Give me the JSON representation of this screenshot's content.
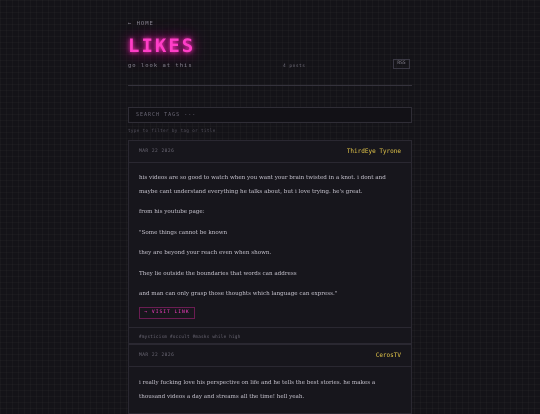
{
  "nav": {
    "home": "← HOME"
  },
  "header": {
    "title": "LIKES",
    "subtitle": "go look at this",
    "count": "4 posts",
    "rss": "RSS"
  },
  "search": {
    "label": "SEARCH TAGS ---",
    "hint": "type to filter by tag or title"
  },
  "posts": [
    {
      "date": "MAR 22 2026",
      "author": "ThirdEye Tyrone",
      "paragraphs": [
        "his videos are so good to watch when you want your brain twisted in a knot. i dont and maybe cant understand everything he talks about, but i love trying. he's great.",
        "from his youtube page:",
        "\"Some things cannot be known",
        "they are beyond your reach even when shown.",
        "They lie outside the boundaries that words can address",
        "and man can only grasp those thoughts which language can express.\""
      ],
      "link": "→ VISIT LINK",
      "tags": "#mysticism #occult #masks while high"
    },
    {
      "date": "MAR 22 2026",
      "author": "CerosTV",
      "paragraphs": [
        "i really fucking love his perspective on life and he tells the best stories. he makes a thousand videos a day and streams all the time! hell yeah."
      ]
    }
  ],
  "colors": {
    "accent": "#ff3ec8",
    "author": "#e6c84a",
    "background": "#141318"
  }
}
